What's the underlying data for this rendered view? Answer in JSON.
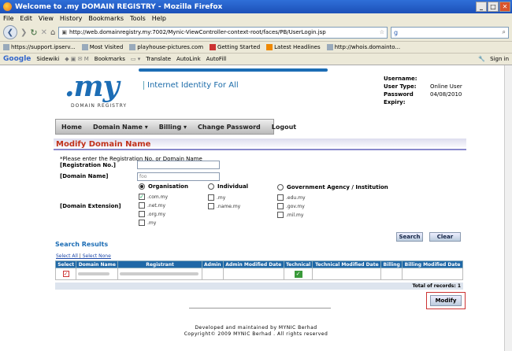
{
  "window": {
    "title": "Welcome to .my DOMAIN REGISTRY - Mozilla Firefox"
  },
  "menu": [
    "File",
    "Edit",
    "View",
    "History",
    "Bookmarks",
    "Tools",
    "Help"
  ],
  "nav": {
    "url": "http://web.domainregistry.my:7002/Mynic-ViewController-context-root/faces/PB/UserLogin.jsp"
  },
  "bookmarks": [
    "https://support.ipserv...",
    "Most Visited",
    "playhouse-pictures.com",
    "Getting Started",
    "Latest Headlines",
    "http://whois.domainto..."
  ],
  "googlebar": {
    "logo": "Google",
    "items": [
      "Sidewiki",
      "Bookmarks",
      "Translate",
      "AutoLink",
      "AutoFill"
    ],
    "signin": "Sign in"
  },
  "header": {
    "logo": ".my",
    "logo_sub": "DOMAIN REGISTRY",
    "tagline": "Internet Identity For All",
    "user": [
      {
        "k": "Username:",
        "v": ""
      },
      {
        "k": "User Type:",
        "v": "Online User"
      },
      {
        "k": "Password Expiry:",
        "v": "04/08/2010"
      }
    ]
  },
  "mainnav": [
    "Home",
    "Domain Name",
    "Billing",
    "Change Password",
    "Logout"
  ],
  "page": {
    "title": "Modify Domain Name",
    "instruction": "*Please enter the Registration No. or Domain Name",
    "reg_label": "[Registration No.]",
    "domain_label": "[Domain Name]",
    "domain_value": "foo",
    "ext_label": "[Domain Extension]",
    "radios": [
      {
        "label": "Organisation",
        "checked": true
      },
      {
        "label": "Individual",
        "checked": false
      },
      {
        "label": "Government Agency / Institution",
        "checked": false
      }
    ],
    "org_ext": [
      {
        "label": ".com.my",
        "checked": true
      },
      {
        "label": ".net.my",
        "checked": false
      },
      {
        "label": ".org.my",
        "checked": false
      },
      {
        "label": ".my",
        "checked": false
      }
    ],
    "ind_ext": [
      {
        "label": ".my"
      },
      {
        "label": ".name.my"
      }
    ],
    "gov_ext": [
      {
        "label": ".edu.my"
      },
      {
        "label": ".gov.my"
      },
      {
        "label": ".mil.my"
      }
    ],
    "search_btn": "Search",
    "clear_btn": "Clear"
  },
  "results": {
    "title": "Search Results",
    "select_all": "Select All",
    "select_none": "Select None",
    "sep": "|",
    "columns": [
      "Select",
      "Domain Name",
      "Registrant",
      "Admin",
      "Admin Modified Date",
      "Technical",
      "Technical Modified Date",
      "Billing",
      "Billing Modified Date"
    ],
    "total": "Total of records: 1",
    "modify_btn": "Modify"
  },
  "footer": {
    "line1": "Developed and maintained by MYNIC Berhad",
    "line2": "Copyright© 2009 MYNIC Berhad . All rights reserved"
  }
}
